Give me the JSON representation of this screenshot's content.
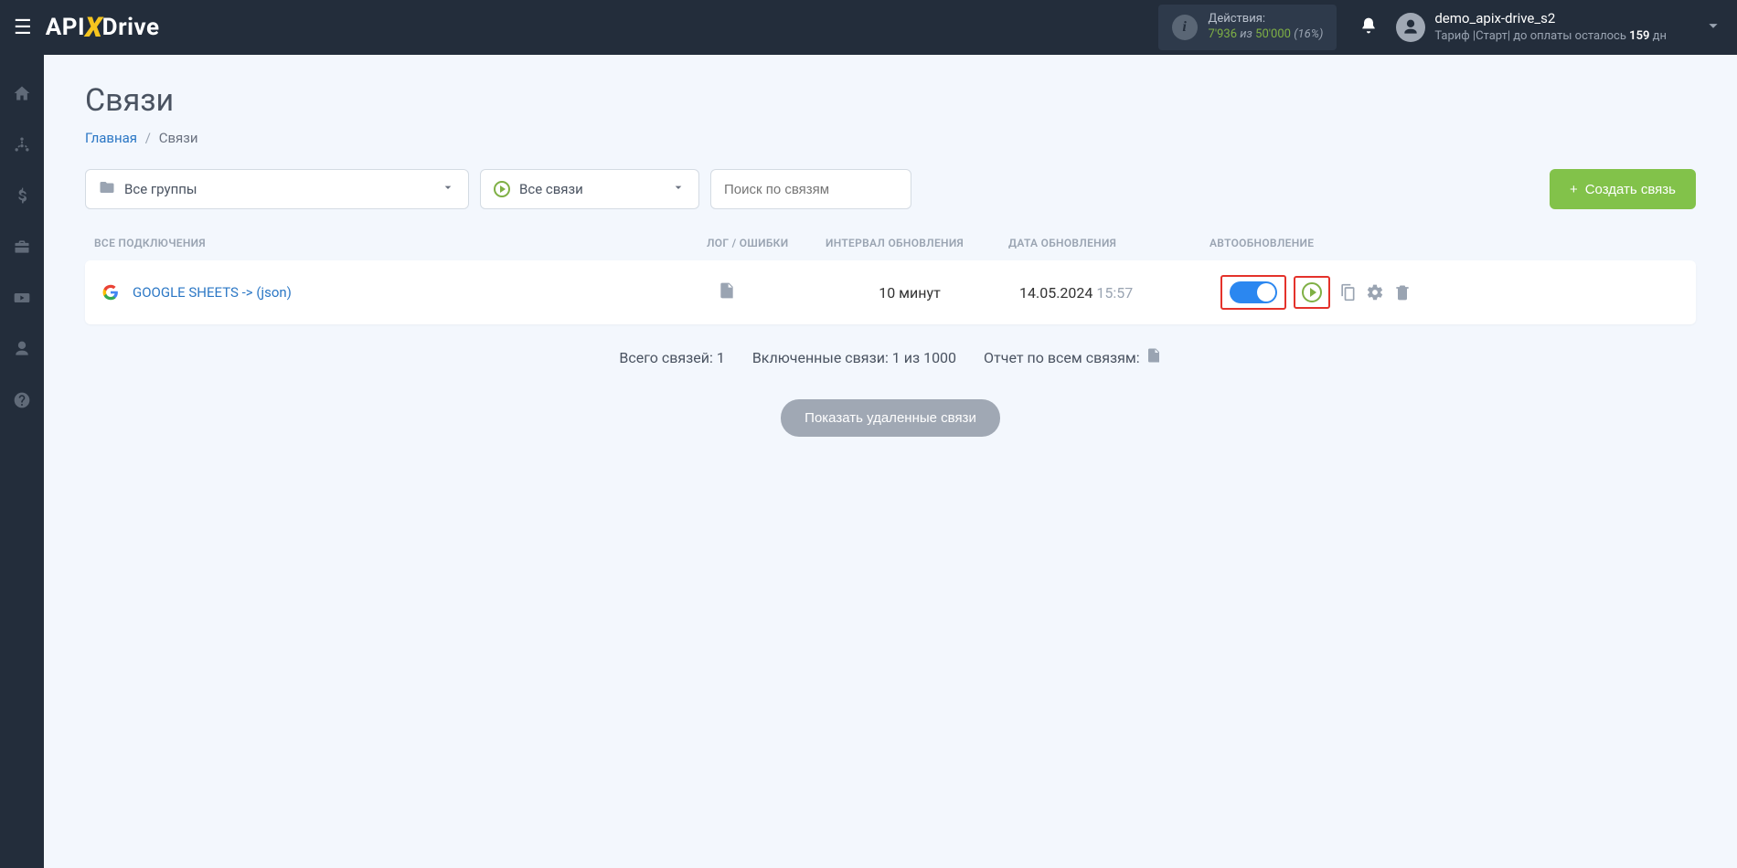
{
  "header": {
    "actions_label": "Действия:",
    "actions_current": "7'936",
    "actions_iz": "из",
    "actions_limit": "50'000",
    "actions_pct": "(16%)",
    "user_name": "demo_apix-drive_s2",
    "plan_prefix": "Тариф |Старт| до оплаты осталось ",
    "plan_days": "159",
    "plan_suffix": " дн"
  },
  "page": {
    "title": "Связи",
    "breadcrumb_home": "Главная",
    "breadcrumb_current": "Связи"
  },
  "filters": {
    "groups": "Все группы",
    "connections": "Все связи",
    "search_placeholder": "Поиск по связям",
    "create_btn": "Создать связь"
  },
  "columns": {
    "name": "ВСЕ ПОДКЛЮЧЕНИЯ",
    "log": "ЛОГ / ОШИБКИ",
    "interval": "ИНТЕРВАЛ ОБНОВЛЕНИЯ",
    "date": "ДАТА ОБНОВЛЕНИЯ",
    "auto": "АВТООБНОВЛЕНИЕ"
  },
  "row": {
    "name": "GOOGLE SHEETS -> (json)",
    "interval": "10 минут",
    "date": "14.05.2024",
    "time": "15:57"
  },
  "summary": {
    "total": "Всего связей: 1",
    "enabled": "Включенные связи: 1 из 1000",
    "report": "Отчет по всем связям:"
  },
  "show_deleted": "Показать удаленные связи"
}
